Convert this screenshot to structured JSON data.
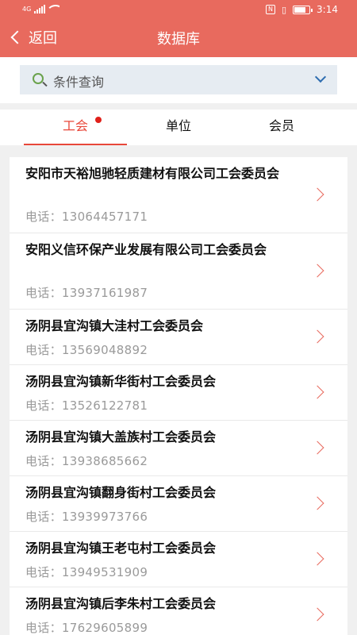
{
  "status_bar": {
    "left_label": "4G",
    "time": "3:14"
  },
  "header": {
    "back_label": "返回",
    "title": "数据库"
  },
  "search": {
    "placeholder": "条件查询"
  },
  "tabs": [
    {
      "label": "工会",
      "active": true,
      "has_badge": true
    },
    {
      "label": "单位",
      "active": false
    },
    {
      "label": "会员",
      "active": false
    }
  ],
  "list": {
    "phone_prefix": "电话：",
    "items": [
      {
        "name": "安阳市天裕旭驰轻质建材有限公司工会委员会",
        "phone": "13064457171"
      },
      {
        "name": "安阳义信环保产业发展有限公司工会委员会",
        "phone": "13937161987"
      },
      {
        "name": "汤阴县宜沟镇大洼村工会委员会",
        "phone": "13569048892"
      },
      {
        "name": "汤阴县宜沟镇新华街村工会委员会",
        "phone": "13526122781"
      },
      {
        "name": "汤阴县宜沟镇大盖族村工会委员会",
        "phone": "13938685662"
      },
      {
        "name": "汤阴县宜沟镇翻身街村工会委员会",
        "phone": "13939973766"
      },
      {
        "name": "汤阴县宜沟镇王老屯村工会委员会",
        "phone": "13949531909"
      },
      {
        "name": "汤阴县宜沟镇后李朱村工会委员会",
        "phone": "17629605899"
      }
    ]
  },
  "colors": {
    "header_bg": "#e86a5e",
    "active_tab": "#e8473a",
    "arrow": "#e86a5e"
  }
}
